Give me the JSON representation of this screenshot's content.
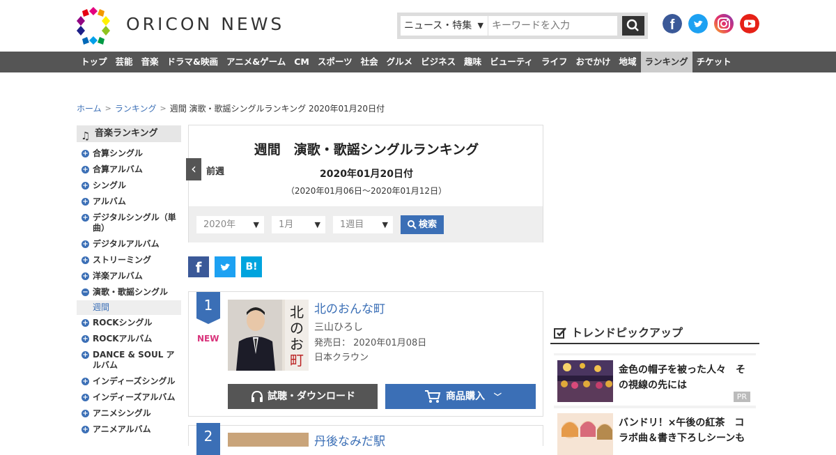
{
  "header": {
    "logo_text": "ORICON NEWS",
    "search_category": "ニュース・特集",
    "search_placeholder": "キーワードを入力"
  },
  "nav": [
    "トップ",
    "芸能",
    "音楽",
    "ドラマ&映画",
    "アニメ&ゲーム",
    "CM",
    "スポーツ",
    "社会",
    "グルメ",
    "ビジネス",
    "趣味",
    "ビューティ",
    "ライフ",
    "おでかけ",
    "地域",
    "ランキング",
    "チケット"
  ],
  "nav_active": "ランキング",
  "breadcrumb": {
    "home": "ホーム",
    "ranking": "ランキング",
    "current": "週間 演歌・歌謡シングルランキング 2020年01月20日付"
  },
  "sidebar": {
    "heading": "音楽ランキング",
    "items": [
      "合算シングル",
      "合算アルバム",
      "シングル",
      "アルバム",
      "デジタルシングル（単曲）",
      "デジタルアルバム",
      "ストリーミング",
      "洋楽アルバム",
      "演歌・歌謡シングル",
      "ROCKシングル",
      "ROCKアルバム",
      "DANCE & SOUL アルバム",
      "インディーズシングル",
      "インディーズアルバム",
      "アニメシングル",
      "アニメアルバム"
    ],
    "sub_item": "週間"
  },
  "main": {
    "title": "週間　演歌・歌謡シングルランキング",
    "prev_label": "前週",
    "date": "2020年01月20日付",
    "range": "（2020年01月06日～2020年01月12日）",
    "filter_year": "2020年",
    "filter_month": "1月",
    "filter_week": "1週目",
    "search_label": "検索"
  },
  "share": {
    "facebook": "f",
    "hatena": "B!"
  },
  "ranking": [
    {
      "rank": "1",
      "new": "NEW",
      "title": "北のおんな町",
      "artist": "三山ひろし",
      "release": "発売日：  2020年01月08日",
      "label": "日本クラウン",
      "listen": "試聴・ダウンロード",
      "buy": "商品購入"
    },
    {
      "rank": "2",
      "title": "丹後なみだ駅"
    }
  ],
  "trend": {
    "heading": "トレンドピックアップ",
    "items": [
      {
        "text": "金色の帽子を被った人々　その視線の先には",
        "tag": "PR"
      },
      {
        "text": "バンドリ！×午後の紅茶　コラボ曲＆書き下ろしシーンも"
      }
    ]
  },
  "colors": {
    "brand_blue": "#3b6fb6",
    "nav_bg": "#555555",
    "new_pink": "#d9337b"
  }
}
